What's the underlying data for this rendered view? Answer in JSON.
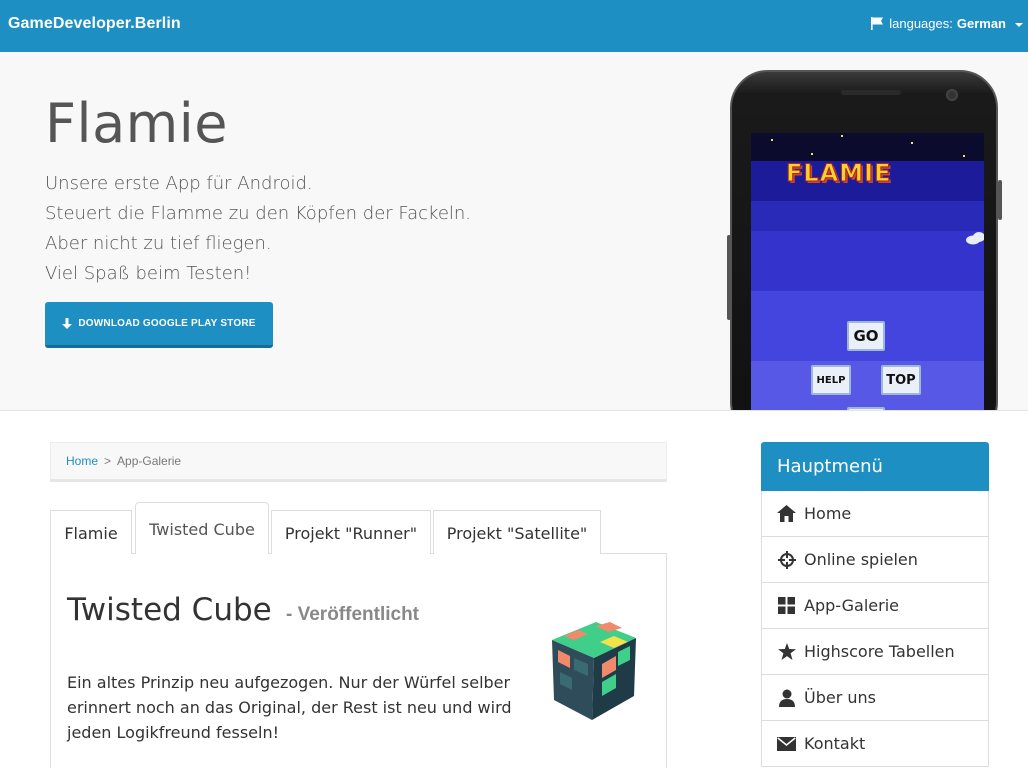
{
  "navbar": {
    "brand": "GameDeveloper.Berlin",
    "languages_label": "languages:",
    "language_value": "German"
  },
  "hero": {
    "title": "Flamie",
    "lines": [
      "Unsere erste App für Android.",
      "Steuert die Flamme zu den Köpfen der Fackeln.",
      "Aber nicht zu tief fliegen.",
      "Viel Spaß beim Testen!"
    ],
    "download_button": "DOWNLOAD GOOGLE PLAY STORE",
    "game_screen": {
      "logo": "FLAMIE",
      "go": "GO",
      "help": "HELP",
      "top": "TOP"
    }
  },
  "breadcrumb": {
    "home": "Home",
    "separator": ">",
    "current": "App-Galerie"
  },
  "tabs": [
    {
      "label": "Flamie",
      "active": false
    },
    {
      "label": "Twisted Cube",
      "active": true
    },
    {
      "label": "Projekt \"Runner\"",
      "active": false
    },
    {
      "label": "Projekt \"Satellite\"",
      "active": false
    }
  ],
  "panel": {
    "title": "Twisted Cube",
    "status": "- Veröffentlicht",
    "description": "Ein altes Prinzip neu aufgezogen. Nur der Würfel selber erinnert noch an das Original, der Rest ist neu und wird jeden Logikfreund fesseln!"
  },
  "sidebar": {
    "heading": "Hauptmenü",
    "items": [
      {
        "label": "Home",
        "icon": "home-icon"
      },
      {
        "label": "Online spielen",
        "icon": "crosshair-icon"
      },
      {
        "label": "App-Galerie",
        "icon": "grid-icon"
      },
      {
        "label": "Highscore Tabellen",
        "icon": "star-icon"
      },
      {
        "label": "Über uns",
        "icon": "user-icon"
      },
      {
        "label": "Kontakt",
        "icon": "envelope-icon"
      }
    ]
  },
  "colors": {
    "primary": "#1e8fc3",
    "hero_bg": "#f8f8f8",
    "text": "#333333"
  }
}
